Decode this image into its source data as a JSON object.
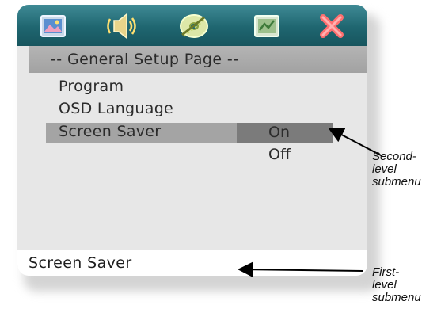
{
  "tabs": [
    {
      "name": "picture-tab",
      "icon": "picture-icon"
    },
    {
      "name": "audio-tab",
      "icon": "speaker-icon"
    },
    {
      "name": "disc-tab",
      "icon": "disc-icon"
    },
    {
      "name": "preferences-tab",
      "icon": "preferences-icon"
    },
    {
      "name": "exit-tab",
      "icon": "close-icon"
    }
  ],
  "page_title": "-- General Setup Page --",
  "menu_items": [
    "Program",
    "OSD Language",
    "Screen Saver"
  ],
  "selected_menu_item": "Screen Saver",
  "submenu_options": [
    "On",
    "Off"
  ],
  "selected_option": "On",
  "status_text": "Screen Saver",
  "annotations": {
    "second_level": "Second-\nlevel\nsubmenu",
    "first_level": "First-\nlevel\nsubmenu"
  },
  "colors": {
    "icon_bar": "#1f6670",
    "title_bar": "#a8a8a8",
    "menu_bg": "#e7e7e7",
    "highlight_row": "#a4a4a4",
    "selected_option": "#7b7b7b",
    "exit_icon": "#ff6f6f"
  }
}
